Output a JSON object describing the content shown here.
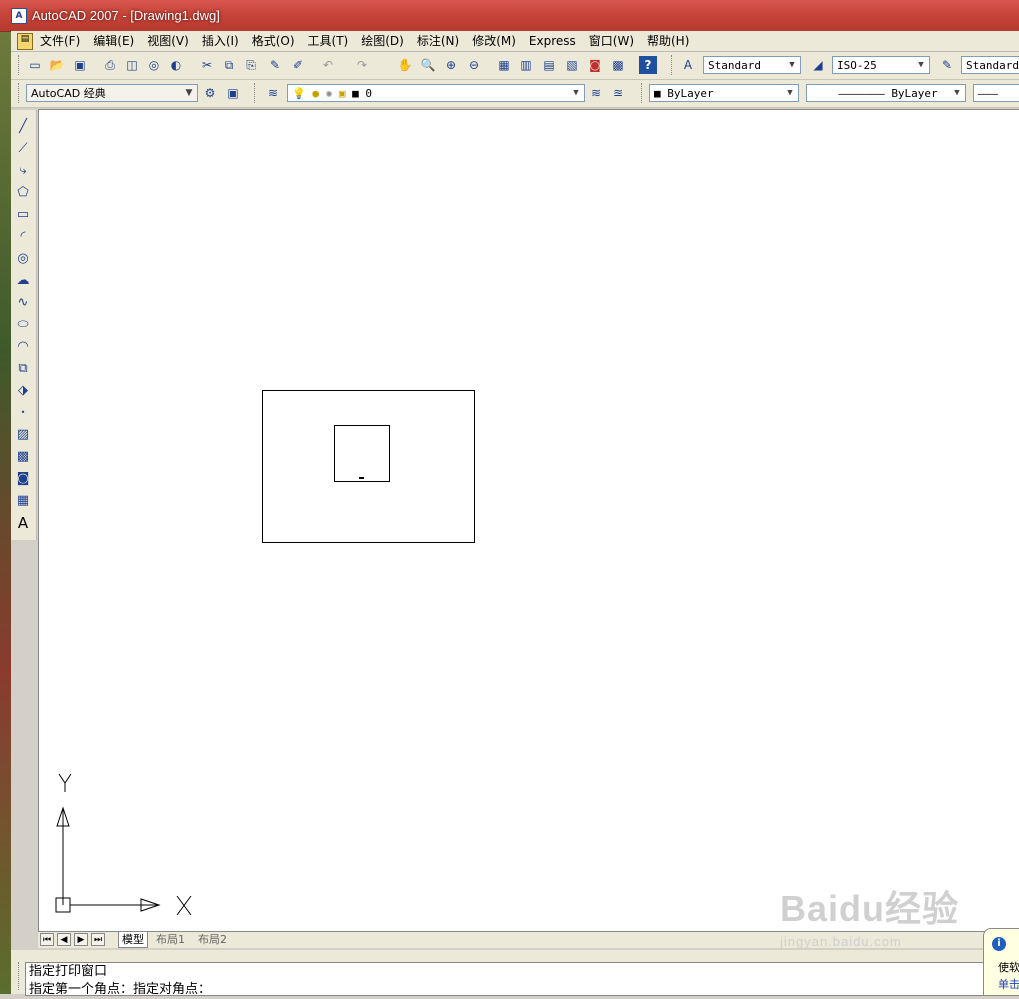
{
  "window": {
    "title": "AutoCAD 2007 - [Drawing1.dwg]",
    "app_icon_text": "A"
  },
  "menubar": {
    "items": [
      "文件(F)",
      "编辑(E)",
      "视图(V)",
      "插入(I)",
      "格式(O)",
      "工具(T)",
      "绘图(D)",
      "标注(N)",
      "修改(M)",
      "Express",
      "窗口(W)",
      "帮助(H)"
    ]
  },
  "toolbar_standard": {
    "text_style": "Standard",
    "dim_style": "ISO-25",
    "table_style": "Standard"
  },
  "toolbar_layers": {
    "workspace": "AutoCAD 经典",
    "current_layer": "0",
    "color": "ByLayer",
    "linetype": "ByLayer"
  },
  "left_tools": {
    "text_tool_label": "A"
  },
  "axes": {
    "x_label": "X",
    "y_label": "Y"
  },
  "layout_tabs": {
    "tabs": [
      "模型",
      "布局1",
      "布局2"
    ],
    "active": "模型"
  },
  "command_line": {
    "lines": [
      "指定打印窗口",
      "指定第一个角点：指定对角点："
    ]
  },
  "balloon": {
    "line1": "使软",
    "line2": "单击"
  },
  "watermark": {
    "title": "Baidu经验",
    "url": "jingyan.baidu.com"
  },
  "colors": {
    "title_bar": "#c8463a",
    "canvas": "#ffffff",
    "chrome": "#ece9d8"
  }
}
